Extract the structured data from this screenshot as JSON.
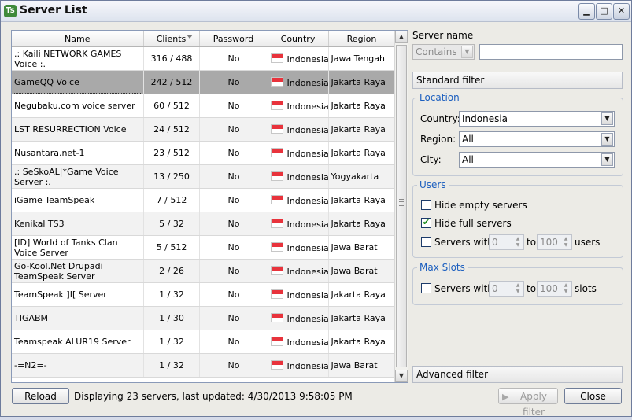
{
  "window": {
    "title": "Server List",
    "app_icon_text": "Ts"
  },
  "columns": [
    "Name",
    "Clients",
    "Password",
    "Country",
    "Region"
  ],
  "rows": [
    {
      "name": ".: Kaili NETWORK GAMES Voice :.",
      "clients": "316 / 488",
      "password": "No",
      "country": "Indonesia",
      "region": "Jawa Tengah"
    },
    {
      "name": "GameQQ Voice",
      "clients": "242 / 512",
      "password": "No",
      "country": "Indonesia",
      "region": "Jakarta Raya"
    },
    {
      "name": "Negubaku.com voice server",
      "clients": "60 / 512",
      "password": "No",
      "country": "Indonesia",
      "region": "Jakarta Raya"
    },
    {
      "name": "LST RESURRECTION Voice",
      "clients": "24 / 512",
      "password": "No",
      "country": "Indonesia",
      "region": "Jakarta Raya"
    },
    {
      "name": "Nusantara.net-1",
      "clients": "23 / 512",
      "password": "No",
      "country": "Indonesia",
      "region": "Jakarta Raya"
    },
    {
      "name": ".: SeSkoAL|*Game Voice Server :.",
      "clients": "13 / 250",
      "password": "No",
      "country": "Indonesia",
      "region": "Yogyakarta"
    },
    {
      "name": "iGame TeamSpeak",
      "clients": "7 / 512",
      "password": "No",
      "country": "Indonesia",
      "region": "Jakarta Raya"
    },
    {
      "name": "Kenikal TS3",
      "clients": "5 / 32",
      "password": "No",
      "country": "Indonesia",
      "region": "Jakarta Raya"
    },
    {
      "name": "[ID] World of Tanks Clan Voice Server",
      "clients": "5 / 512",
      "password": "No",
      "country": "Indonesia",
      "region": "Jawa Barat"
    },
    {
      "name": "Go-Kool.Net Drupadi TeamSpeak Server",
      "clients": "2 / 26",
      "password": "No",
      "country": "Indonesia",
      "region": "Jawa Barat"
    },
    {
      "name": "TeamSpeak ]I[ Server",
      "clients": "1 / 32",
      "password": "No",
      "country": "Indonesia",
      "region": "Jakarta Raya"
    },
    {
      "name": "TIGABM",
      "clients": "1 / 30",
      "password": "No",
      "country": "Indonesia",
      "region": "Jakarta Raya"
    },
    {
      "name": "Teamspeak ALUR19 Server",
      "clients": "1 / 32",
      "password": "No",
      "country": "Indonesia",
      "region": "Jakarta Raya"
    },
    {
      "name": "-=N2=-",
      "clients": "1 / 32",
      "password": "No",
      "country": "Indonesia",
      "region": "Jawa Barat"
    }
  ],
  "selected_row": 1,
  "bottom": {
    "reload": "Reload",
    "status": "Displaying 23 servers, last updated: 4/30/2013 9:58:05 PM",
    "apply": "Apply filter",
    "close": "Close"
  },
  "filter": {
    "server_name_label": "Server name",
    "match_mode": "Contains",
    "server_name_value": "",
    "standard_filter": "Standard filter",
    "location": {
      "title": "Location",
      "country_label": "Country:",
      "country": "Indonesia",
      "region_label": "Region:",
      "region": "All",
      "city_label": "City:",
      "city": "All"
    },
    "users": {
      "title": "Users",
      "hide_empty": "Hide empty servers",
      "hide_empty_checked": false,
      "hide_full": "Hide full servers",
      "hide_full_checked": true,
      "servers_with": "Servers with",
      "servers_with_checked": false,
      "min": "0",
      "to": "to",
      "max": "100",
      "unit": "users"
    },
    "max_slots": {
      "title": "Max Slots",
      "servers_with": "Servers with",
      "checked": false,
      "min": "0",
      "to": "to",
      "max": "100",
      "unit": "slots"
    },
    "advanced_filter": "Advanced filter"
  },
  "colors": {
    "selected_row": "#a9a9a9",
    "group_title": "#1c5fbf"
  }
}
